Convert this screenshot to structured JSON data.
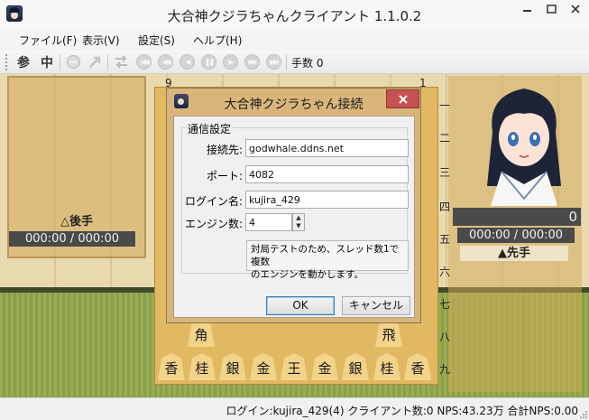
{
  "window": {
    "title": "大合神クジラちゃんクライアント 1.1.0.2"
  },
  "menu": {
    "items": [
      "ファイル(F)",
      "表示(V)",
      "設定(S)",
      "ヘルプ(H)"
    ]
  },
  "toolbar": {
    "ref_label": "参",
    "stop_label": "中",
    "moves_label": "手数 0"
  },
  "board": {
    "file_labels": [
      "9",
      "1"
    ],
    "rank_labels": [
      "一",
      "二",
      "三",
      "四",
      "五",
      "六",
      "七",
      "八",
      "九"
    ],
    "rook": "飛",
    "bishop": "角",
    "back_rank": [
      "香",
      "桂",
      "銀",
      "金",
      "王",
      "金",
      "銀",
      "桂",
      "香"
    ]
  },
  "players": {
    "gote_label": "△後手",
    "gote_clock": "000:00 / 000:00",
    "sente_label": "▲先手",
    "sente_clock": "000:00 / 000:00",
    "sente_score": "0"
  },
  "dialog": {
    "title": "大合神クジラちゃん接続",
    "group_label": "通信設定",
    "host_label": "接続先:",
    "host_value": "godwhale.ddns.net",
    "port_label": "ポート:",
    "port_value": "4082",
    "login_label": "ログイン名:",
    "login_value": "kujira_429",
    "engines_label": "エンジン数:",
    "engines_value": "4",
    "note_line1": "対局テストのため、スレッド数1で複数",
    "note_line2": "のエンジンを動かします。",
    "ok_label": "OK",
    "cancel_label": "キャンセル"
  },
  "status": {
    "text": "ログイン:kujira_429(4)  クライアント数:0  NPS:43.23万  合計NPS:0.00"
  },
  "colors": {
    "close_button": "#c75050",
    "dialog_frame": "#d9b57a",
    "board": "#e2b963"
  }
}
